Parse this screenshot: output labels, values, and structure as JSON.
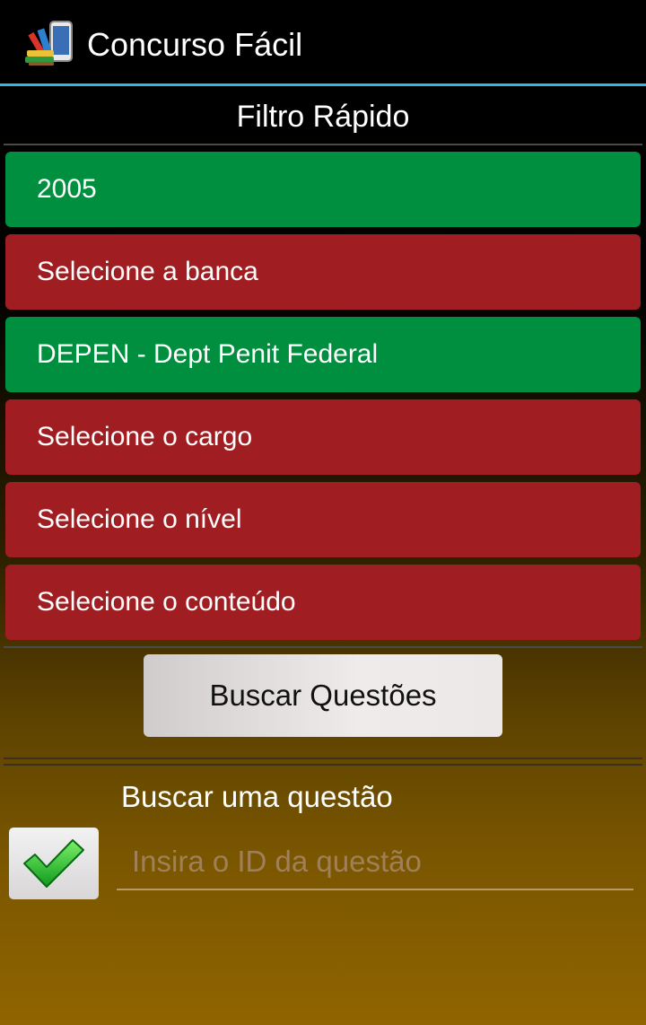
{
  "action_bar": {
    "title": "Concurso Fácil",
    "icon": "books-phone-icon",
    "accent_color": "#33b5e5"
  },
  "filter": {
    "title": "Filtro Rápido",
    "items": [
      {
        "label": "2005",
        "state": "selected",
        "color": "#008f3f"
      },
      {
        "label": "Selecione a banca",
        "state": "unselected",
        "color": "#a01d21"
      },
      {
        "label": "DEPEN - Dept Penit Federal",
        "state": "selected",
        "color": "#008f3f"
      },
      {
        "label": "Selecione o cargo",
        "state": "unselected",
        "color": "#a01d21"
      },
      {
        "label": "Selecione o nível",
        "state": "unselected",
        "color": "#a01d21"
      },
      {
        "label": "Selecione o conteúdo",
        "state": "unselected",
        "color": "#a01d21"
      }
    ],
    "search_button": "Buscar Questões"
  },
  "id_search": {
    "label": "Buscar uma questão",
    "input_value": "",
    "input_placeholder": "Insira o ID da questão",
    "confirm_icon": "green-checkmark-icon"
  }
}
